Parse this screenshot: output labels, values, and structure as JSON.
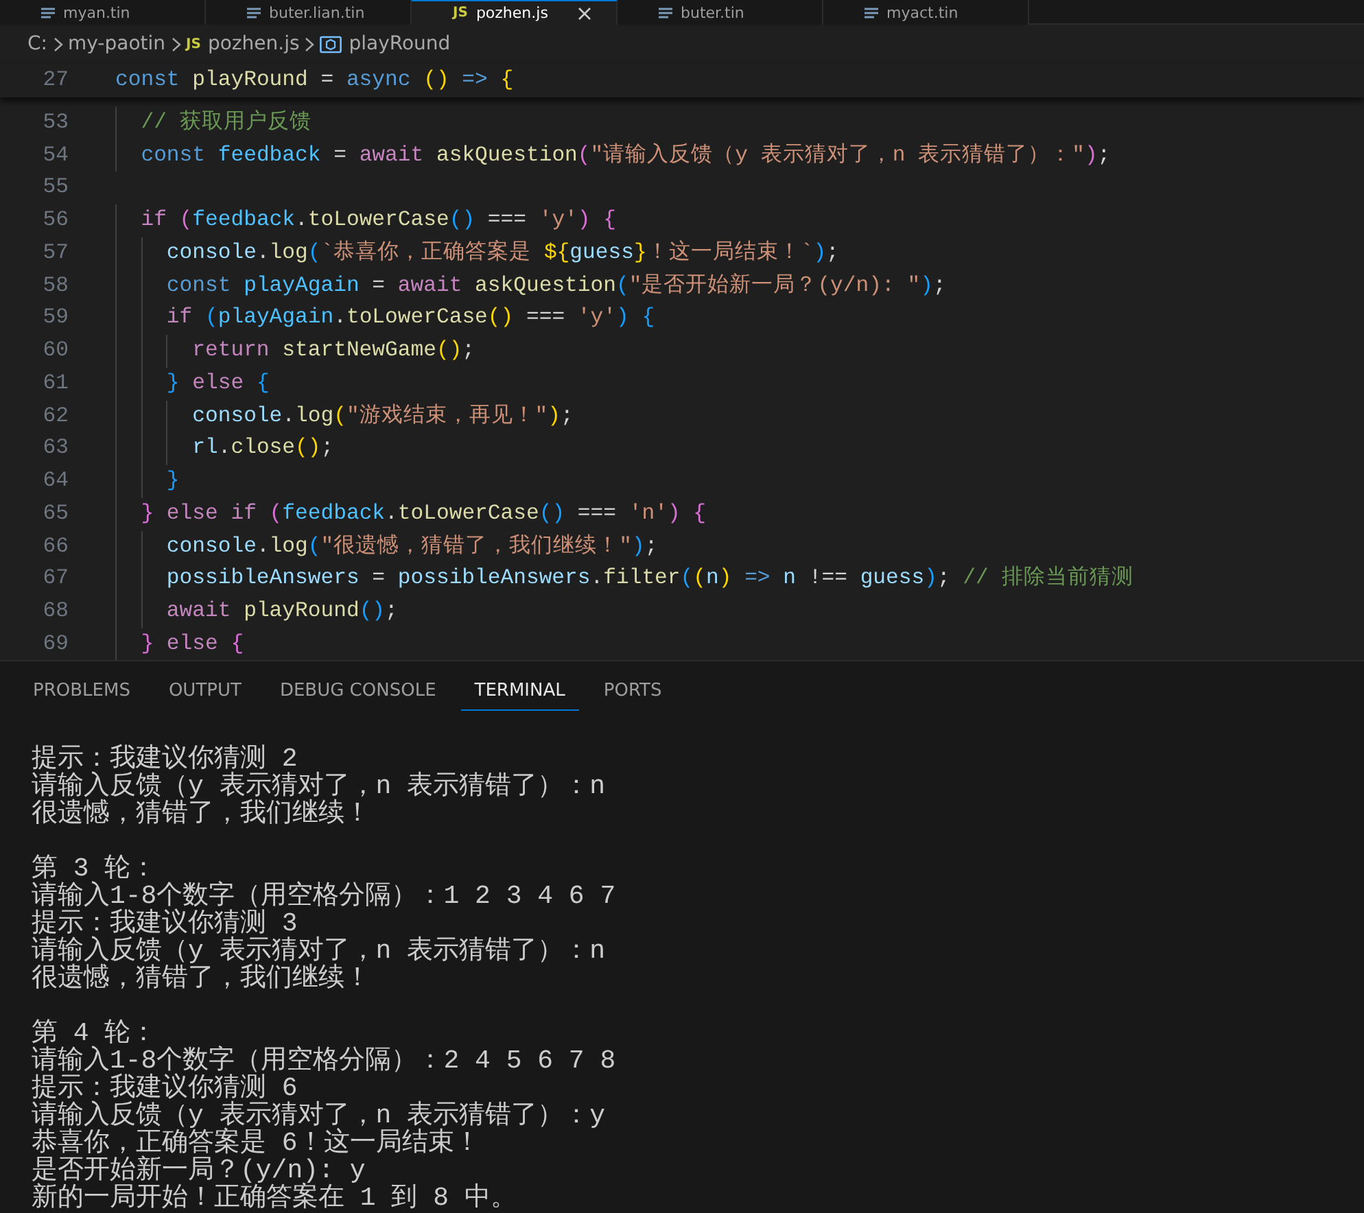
{
  "editor_tabs": [
    {
      "label": "myan.tin",
      "kind": "plain",
      "selected": false
    },
    {
      "label": "buter.lian.tin",
      "kind": "plain",
      "selected": false
    },
    {
      "label": "pozhen.js",
      "kind": "js",
      "icon_label": "JS",
      "selected": true
    },
    {
      "label": "buter.tin",
      "kind": "plain",
      "selected": false
    },
    {
      "label": "myact.tin",
      "kind": "plain",
      "selected": false
    }
  ],
  "breadcrumbs": [
    {
      "label": "C:",
      "kind": "folder"
    },
    {
      "label": "my-paotin",
      "kind": "folder"
    },
    {
      "label": "pozhen.js",
      "kind": "js",
      "icon_label": "JS"
    },
    {
      "label": "playRound",
      "kind": "symbol"
    }
  ],
  "sticky_line": {
    "number": "27",
    "tokens": [
      {
        "text": "const",
        "kind": "kw"
      },
      {
        "text": " playRound",
        "kind": "fn"
      },
      {
        "text": " = ",
        "kind": "p"
      },
      {
        "text": "async",
        "kind": "kw"
      },
      {
        "text": " (",
        "kind": "b1"
      },
      {
        "text": ")",
        "kind": "b1"
      },
      {
        "text": " =>",
        "kind": "kw"
      },
      {
        "text": " {",
        "kind": "b1"
      }
    ]
  },
  "code_lines": [
    {
      "number": "53",
      "tokens": [
        {
          "text": "  // 获取用户反馈",
          "kind": "cmt"
        }
      ]
    },
    {
      "number": "54",
      "tokens": [
        {
          "text": "  const",
          "kind": "kw"
        },
        {
          "text": " feedback",
          "kind": "cst"
        },
        {
          "text": " = ",
          "kind": "p"
        },
        {
          "text": "await",
          "kind": "ctl"
        },
        {
          "text": " askQuestion",
          "kind": "fn"
        },
        {
          "text": "(",
          "kind": "b2"
        },
        {
          "text": "\"请输入反馈（y 表示猜对了，n 表示猜错了）：\"",
          "kind": "str"
        },
        {
          "text": ")",
          "kind": "b2"
        },
        {
          "text": ";",
          "kind": "p"
        }
      ]
    },
    {
      "number": "55"
    },
    {
      "number": "56",
      "tokens": [
        {
          "text": "  if",
          "kind": "ctl"
        },
        {
          "text": " (",
          "kind": "b2"
        },
        {
          "text": "feedback",
          "kind": "cst"
        },
        {
          "text": ".",
          "kind": "p"
        },
        {
          "text": "toLowerCase",
          "kind": "fn"
        },
        {
          "text": "(",
          "kind": "b3"
        },
        {
          "text": ")",
          "kind": "b3"
        },
        {
          "text": " === ",
          "kind": "p"
        },
        {
          "text": "'y'",
          "kind": "str"
        },
        {
          "text": ")",
          "kind": "b2"
        },
        {
          "text": " {",
          "kind": "b2"
        }
      ]
    },
    {
      "number": "57",
      "tokens": [
        {
          "text": "    console",
          "kind": "var"
        },
        {
          "text": ".",
          "kind": "p"
        },
        {
          "text": "log",
          "kind": "fn"
        },
        {
          "text": "(",
          "kind": "b3"
        },
        {
          "text": "`恭喜你，正确答案是 ",
          "kind": "str"
        },
        {
          "text": "${",
          "kind": "b1"
        },
        {
          "text": "guess",
          "kind": "var"
        },
        {
          "text": "}",
          "kind": "b1"
        },
        {
          "text": "！这一局结束！`",
          "kind": "str"
        },
        {
          "text": ")",
          "kind": "b3"
        },
        {
          "text": ";",
          "kind": "p"
        }
      ]
    },
    {
      "number": "58",
      "tokens": [
        {
          "text": "    const",
          "kind": "kw"
        },
        {
          "text": " playAgain",
          "kind": "cst"
        },
        {
          "text": " = ",
          "kind": "p"
        },
        {
          "text": "await",
          "kind": "ctl"
        },
        {
          "text": " askQuestion",
          "kind": "fn"
        },
        {
          "text": "(",
          "kind": "b3"
        },
        {
          "text": "\"是否开始新一局？(y/n): \"",
          "kind": "str"
        },
        {
          "text": ")",
          "kind": "b3"
        },
        {
          "text": ";",
          "kind": "p"
        }
      ]
    },
    {
      "number": "59",
      "tokens": [
        {
          "text": "    if",
          "kind": "ctl"
        },
        {
          "text": " (",
          "kind": "b3"
        },
        {
          "text": "playAgain",
          "kind": "cst"
        },
        {
          "text": ".",
          "kind": "p"
        },
        {
          "text": "toLowerCase",
          "kind": "fn"
        },
        {
          "text": "(",
          "kind": "b1"
        },
        {
          "text": ")",
          "kind": "b1"
        },
        {
          "text": " === ",
          "kind": "p"
        },
        {
          "text": "'y'",
          "kind": "str"
        },
        {
          "text": ")",
          "kind": "b3"
        },
        {
          "text": " {",
          "kind": "b3"
        }
      ]
    },
    {
      "number": "60",
      "tokens": [
        {
          "text": "      return",
          "kind": "ctl"
        },
        {
          "text": " startNewGame",
          "kind": "fn"
        },
        {
          "text": "(",
          "kind": "b1"
        },
        {
          "text": ")",
          "kind": "b1"
        },
        {
          "text": ";",
          "kind": "p"
        }
      ]
    },
    {
      "number": "61",
      "tokens": [
        {
          "text": "    }",
          "kind": "b3"
        },
        {
          "text": " else",
          "kind": "ctl"
        },
        {
          "text": " {",
          "kind": "b3"
        }
      ]
    },
    {
      "number": "62",
      "tokens": [
        {
          "text": "      console",
          "kind": "var"
        },
        {
          "text": ".",
          "kind": "p"
        },
        {
          "text": "log",
          "kind": "fn"
        },
        {
          "text": "(",
          "kind": "b1"
        },
        {
          "text": "\"游戏结束，再见！\"",
          "kind": "str"
        },
        {
          "text": ")",
          "kind": "b1"
        },
        {
          "text": ";",
          "kind": "p"
        }
      ]
    },
    {
      "number": "63",
      "tokens": [
        {
          "text": "      rl",
          "kind": "var"
        },
        {
          "text": ".",
          "kind": "p"
        },
        {
          "text": "close",
          "kind": "fn"
        },
        {
          "text": "(",
          "kind": "b1"
        },
        {
          "text": ")",
          "kind": "b1"
        },
        {
          "text": ";",
          "kind": "p"
        }
      ]
    },
    {
      "number": "64",
      "tokens": [
        {
          "text": "    }",
          "kind": "b3"
        }
      ]
    },
    {
      "number": "65",
      "tokens": [
        {
          "text": "  }",
          "kind": "b2"
        },
        {
          "text": " else",
          "kind": "ctl"
        },
        {
          "text": " if",
          "kind": "ctl"
        },
        {
          "text": " (",
          "kind": "b2"
        },
        {
          "text": "feedback",
          "kind": "cst"
        },
        {
          "text": ".",
          "kind": "p"
        },
        {
          "text": "toLowerCase",
          "kind": "fn"
        },
        {
          "text": "(",
          "kind": "b3"
        },
        {
          "text": ")",
          "kind": "b3"
        },
        {
          "text": " === ",
          "kind": "p"
        },
        {
          "text": "'n'",
          "kind": "str"
        },
        {
          "text": ")",
          "kind": "b2"
        },
        {
          "text": " {",
          "kind": "b2"
        }
      ]
    },
    {
      "number": "66",
      "tokens": [
        {
          "text": "    console",
          "kind": "var"
        },
        {
          "text": ".",
          "kind": "p"
        },
        {
          "text": "log",
          "kind": "fn"
        },
        {
          "text": "(",
          "kind": "b3"
        },
        {
          "text": "\"很遗憾，猜错了，我们继续！\"",
          "kind": "str"
        },
        {
          "text": ")",
          "kind": "b3"
        },
        {
          "text": ";",
          "kind": "p"
        }
      ]
    },
    {
      "number": "67",
      "tokens": [
        {
          "text": "    possibleAnswers",
          "kind": "var"
        },
        {
          "text": " = ",
          "kind": "p"
        },
        {
          "text": "possibleAnswers",
          "kind": "var"
        },
        {
          "text": ".",
          "kind": "p"
        },
        {
          "text": "filter",
          "kind": "fn"
        },
        {
          "text": "(",
          "kind": "b3"
        },
        {
          "text": "(",
          "kind": "b1"
        },
        {
          "text": "n",
          "kind": "var"
        },
        {
          "text": ")",
          "kind": "b1"
        },
        {
          "text": " =>",
          "kind": "kw"
        },
        {
          "text": " n",
          "kind": "var"
        },
        {
          "text": " !== ",
          "kind": "p"
        },
        {
          "text": "guess",
          "kind": "var"
        },
        {
          "text": ")",
          "kind": "b3"
        },
        {
          "text": ";",
          "kind": "p"
        },
        {
          "text": " // 排除当前猜测",
          "kind": "cmt"
        }
      ]
    },
    {
      "number": "68",
      "tokens": [
        {
          "text": "    await",
          "kind": "ctl"
        },
        {
          "text": " playRound",
          "kind": "fn"
        },
        {
          "text": "(",
          "kind": "b3"
        },
        {
          "text": ")",
          "kind": "b3"
        },
        {
          "text": ";",
          "kind": "p"
        }
      ]
    },
    {
      "number": "69",
      "tokens": [
        {
          "text": "  }",
          "kind": "b2"
        },
        {
          "text": " else",
          "kind": "ctl"
        },
        {
          "text": " {",
          "kind": "b2"
        }
      ]
    }
  ],
  "panel_tabs": [
    {
      "label": "PROBLEMS",
      "selected": false
    },
    {
      "label": "OUTPUT",
      "selected": false
    },
    {
      "label": "DEBUG CONSOLE",
      "selected": false
    },
    {
      "label": "TERMINAL",
      "selected": true
    },
    {
      "label": "PORTS",
      "selected": false
    }
  ],
  "terminal": {
    "blocks": [
      [
        "提示：我建议你猜测 2",
        "请输入反馈（y 表示猜对了，n 表示猜错了）：n",
        "很遗憾，猜错了，我们继续！"
      ],
      [
        "第 3 轮：",
        "请输入1-8个数字（用空格分隔）：1 2 3 4 6 7",
        "提示：我建议你猜测 3",
        "请输入反馈（y 表示猜对了，n 表示猜错了）：n",
        "很遗憾，猜错了，我们继续！"
      ],
      [
        "第 4 轮：",
        "请输入1-8个数字（用空格分隔）：2 4 5 6 7 8",
        "提示：我建议你猜测 6",
        "请输入反馈（y 表示猜对了，n 表示猜错了）：y",
        "恭喜你，正确答案是 6！这一局结束！",
        "是否开始新一局？(y/n): y",
        "新的一局开始！正确答案在 1 到 8 中。"
      ]
    ]
  }
}
